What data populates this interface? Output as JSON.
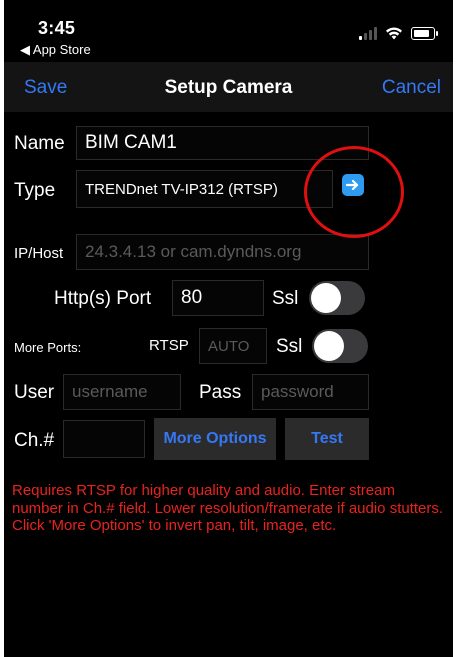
{
  "status_bar": {
    "time": "3:45",
    "back_label": "◀ App Store"
  },
  "nav": {
    "save_label": "Save",
    "title": "Setup Camera",
    "cancel_label": "Cancel",
    "accent_color": "#3478f6"
  },
  "form": {
    "name_label": "Name",
    "name_value": "BIM CAM1",
    "type_label": "Type",
    "type_value": "TRENDnet TV-IP312 (RTSP)",
    "type_button_icon": "arrow-right-icon",
    "host_label": "IP/Host",
    "host_placeholder": "24.3.4.13 or cam.dyndns.org",
    "http_port_label": "Http(s) Port",
    "http_port_value": "80",
    "ssl_label_1": "Ssl",
    "ssl_toggle_1_on": false,
    "more_ports_label": "More Ports:",
    "rtsp_label": "RTSP",
    "rtsp_placeholder": "AUTO",
    "ssl_label_2": "Ssl",
    "ssl_toggle_2_on": false,
    "user_label": "User",
    "user_placeholder": "username",
    "pass_label": "Pass",
    "pass_placeholder": "password",
    "channel_label": "Ch.#",
    "channel_value": "",
    "more_options_label": "More Options",
    "test_label": "Test"
  },
  "notes": {
    "line1": "Requires RTSP for higher quality and audio. Enter stream number in Ch.# field. Lower resolution/framerate if audio stutters.",
    "line2": "Click 'More Options' to invert pan, tilt, image, etc.",
    "color": "#e8231f"
  },
  "annotation": {
    "color": "#e01010",
    "shape": "circle"
  }
}
